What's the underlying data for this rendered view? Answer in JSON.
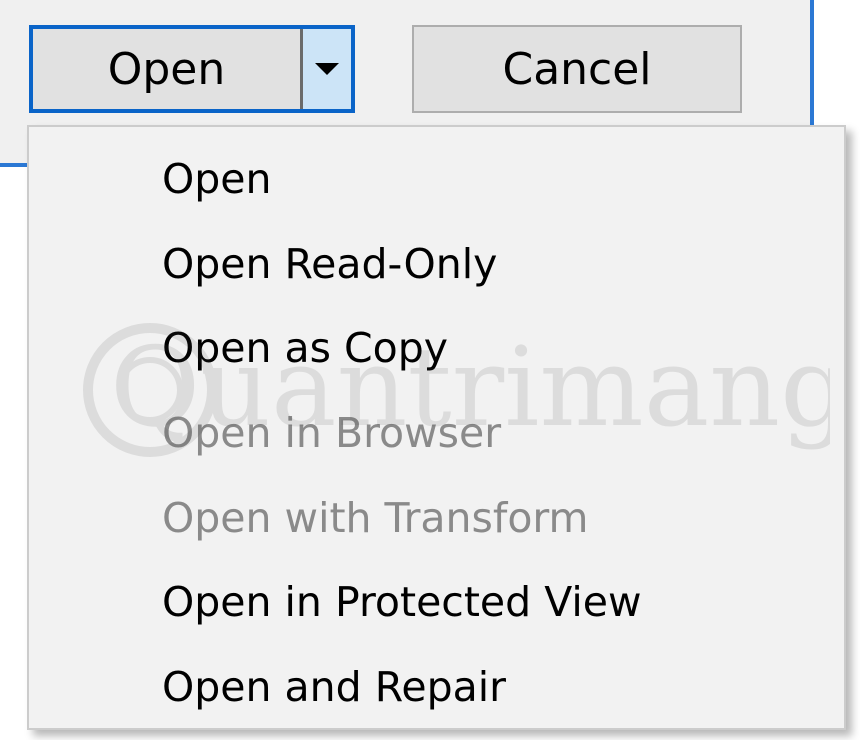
{
  "buttons": {
    "open_label": "Open",
    "cancel_label": "Cancel",
    "dropdown_icon": "chevron-down-icon"
  },
  "menu": {
    "items": [
      {
        "label": "Open",
        "enabled": true
      },
      {
        "label": "Open Read-Only",
        "enabled": true
      },
      {
        "label": "Open as Copy",
        "enabled": true
      },
      {
        "label": "Open in Browser",
        "enabled": false
      },
      {
        "label": "Open with Transform",
        "enabled": false
      },
      {
        "label": "Open in Protected View",
        "enabled": true
      },
      {
        "label": "Open and Repair",
        "enabled": true
      }
    ]
  },
  "watermark": {
    "text": "Quantrimang"
  },
  "colors": {
    "focus_blue": "#0a64c8",
    "button_face": "#e1e1e1",
    "menu_background": "#f2f2f2",
    "disabled_text": "#8a8a8a"
  }
}
